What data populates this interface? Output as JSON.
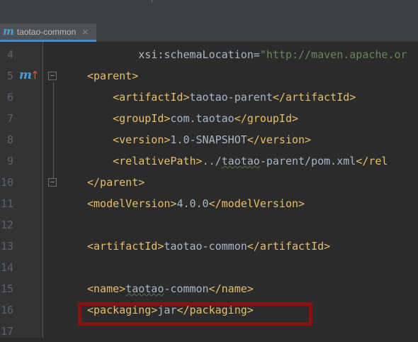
{
  "tab": {
    "icon": "m",
    "label": "taotao-common",
    "close": "×"
  },
  "lines": [
    {
      "num": "4",
      "segments": [
        {
          "c": "at",
          "t": "        xsi"
        },
        {
          "c": "txt",
          "t": ":schemaLocation="
        },
        {
          "c": "str",
          "t": "\"http://maven.apache.or"
        }
      ]
    },
    {
      "num": "5",
      "segments": [
        {
          "c": "tg",
          "t": "<parent>"
        }
      ]
    },
    {
      "num": "6",
      "segments": [
        {
          "c": "txt",
          "t": "    "
        },
        {
          "c": "tg",
          "t": "<artifactId>"
        },
        {
          "c": "txt",
          "t": "taotao-parent"
        },
        {
          "c": "tg",
          "t": "</artifactId>"
        }
      ]
    },
    {
      "num": "7",
      "segments": [
        {
          "c": "txt",
          "t": "    "
        },
        {
          "c": "tg",
          "t": "<groupId>"
        },
        {
          "c": "txt",
          "t": "com.taotao"
        },
        {
          "c": "tg",
          "t": "</groupId>"
        }
      ]
    },
    {
      "num": "8",
      "segments": [
        {
          "c": "txt",
          "t": "    "
        },
        {
          "c": "tg",
          "t": "<version>"
        },
        {
          "c": "txt",
          "t": "1.0-SNAPSHOT"
        },
        {
          "c": "tg",
          "t": "</version>"
        }
      ]
    },
    {
      "num": "9",
      "segments": [
        {
          "c": "txt",
          "t": "    "
        },
        {
          "c": "tg",
          "t": "<relativePath>"
        },
        {
          "c": "txt",
          "t": "../"
        },
        {
          "c": "txt sq",
          "t": "taotao"
        },
        {
          "c": "txt",
          "t": "-parent/pom.xml"
        },
        {
          "c": "tg",
          "t": "</rel"
        }
      ]
    },
    {
      "num": "10",
      "segments": [
        {
          "c": "tg",
          "t": "</parent>"
        }
      ]
    },
    {
      "num": "11",
      "segments": [
        {
          "c": "tg",
          "t": "<modelVersion>"
        },
        {
          "c": "txt",
          "t": "4.0.0"
        },
        {
          "c": "tg",
          "t": "</modelVersion>"
        }
      ]
    },
    {
      "num": "12",
      "segments": []
    },
    {
      "num": "13",
      "segments": [
        {
          "c": "tg",
          "t": "<artifactId>"
        },
        {
          "c": "txt",
          "t": "taotao-common"
        },
        {
          "c": "tg",
          "t": "</artifactId>"
        }
      ]
    },
    {
      "num": "14",
      "segments": []
    },
    {
      "num": "15",
      "segments": [
        {
          "c": "tg",
          "t": "<name>"
        },
        {
          "c": "txt sq",
          "t": "taotao"
        },
        {
          "c": "txt",
          "t": "-common"
        },
        {
          "c": "tg",
          "t": "</name>"
        }
      ]
    },
    {
      "num": "16",
      "segments": [
        {
          "c": "tg",
          "t": "<packaging>"
        },
        {
          "c": "txt",
          "t": "jar"
        },
        {
          "c": "tg",
          "t": "</packaging>"
        }
      ]
    },
    {
      "num": "17",
      "segments": []
    }
  ],
  "gutter_markers": {
    "line5": {
      "icon": "m",
      "arrow": "↑"
    }
  },
  "highlight_color": "#8b1111"
}
